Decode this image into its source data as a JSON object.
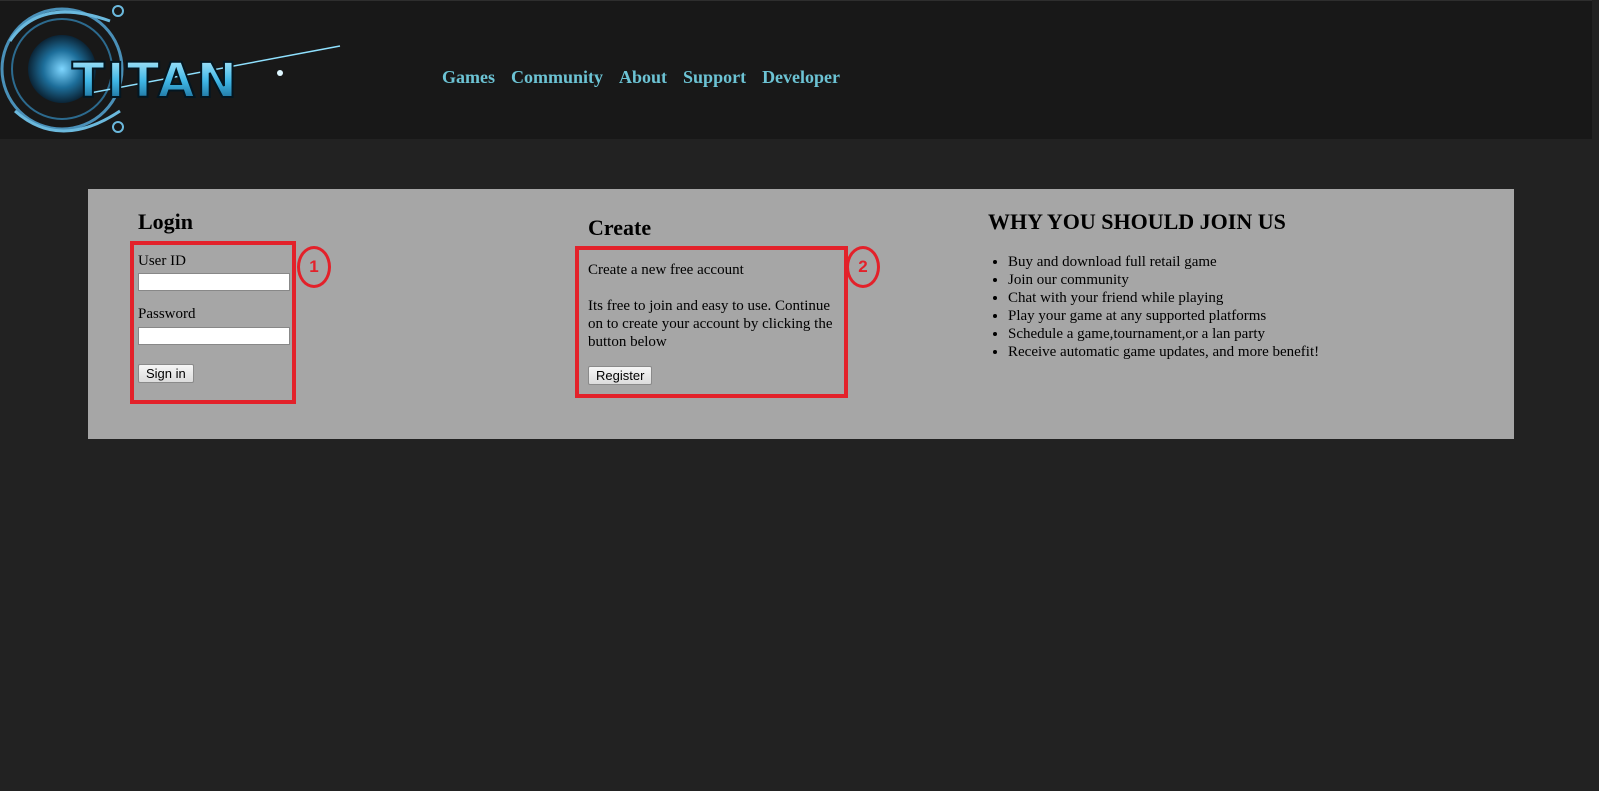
{
  "header": {
    "logo_text": "TITAN",
    "nav": [
      "Games",
      "Community",
      "About",
      "Support",
      "Developer"
    ]
  },
  "login": {
    "title": "Login",
    "user_id_label": "User ID",
    "user_id_value": "",
    "password_label": "Password",
    "password_value": "",
    "sign_in_label": "Sign in"
  },
  "create": {
    "title": "Create",
    "line1": "Create a new free account",
    "line2": "Its free to join and easy to use. Continue on to create your account by clicking the button below",
    "register_label": "Register"
  },
  "why": {
    "title": "WHY YOU SHOULD JOIN US",
    "items": [
      "Buy and download full retail game",
      "Join our community",
      "Chat with your friend while playing",
      "Play your game at any supported platforms",
      "Schedule a game,tournament,or a lan party",
      "Receive automatic game updates, and more benefit!"
    ]
  },
  "annotations": {
    "marker_1": "1",
    "marker_2": "2",
    "color": "#e3212a"
  },
  "colors": {
    "nav_link": "#6cc3d4",
    "panel_bg": "#a6a6a6",
    "page_bg": "#222222",
    "header_bg": "#181818"
  }
}
